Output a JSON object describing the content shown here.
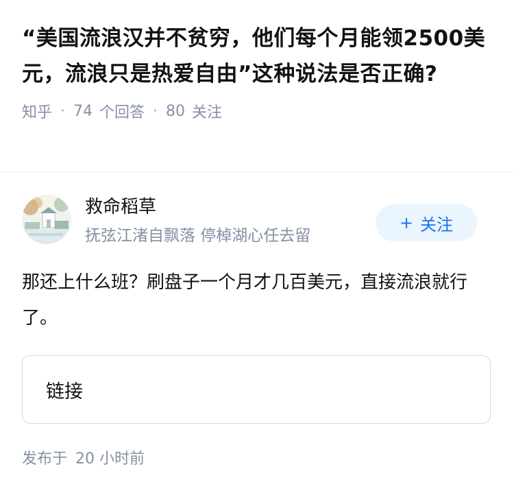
{
  "question": {
    "title": "“美国流浪汉并不贫穷，他们每个月能领2500美元，流浪只是热爱自由”这种说法是否正确?",
    "source": "知乎",
    "answers_count": "74",
    "answers_label": "个回答",
    "follows_count": "80",
    "follows_label": "关注"
  },
  "author": {
    "name": "救命稻草",
    "bio": "抚弦江渚自飘落 停棹湖心任去留",
    "follow_icon": "plus-icon",
    "follow_label": "关注"
  },
  "answer": {
    "text": "那还上什么班？刷盘子一个月才几百美元，直接流浪就行了。",
    "link_label": "链接",
    "published_label": "发布于",
    "published_time": "20 小时前"
  },
  "colors": {
    "accent": "#1772f6",
    "follow_bg": "#ebf5fd",
    "meta_text": "#8590a6"
  }
}
